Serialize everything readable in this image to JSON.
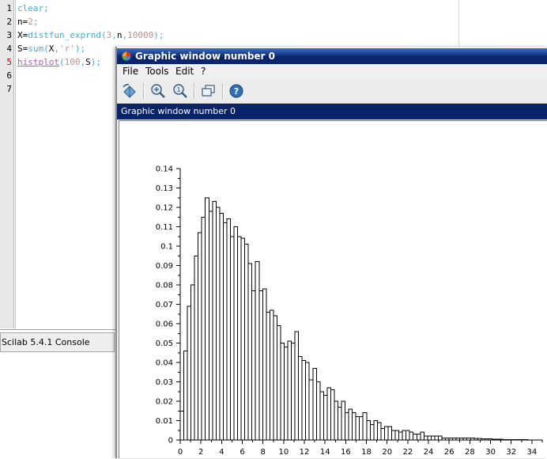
{
  "editor": {
    "line_numbers": [
      "1",
      "2",
      "3",
      "4",
      "5",
      "6",
      "7"
    ],
    "lines": [
      [
        {
          "t": "clear",
          "c": "c-kw"
        },
        {
          "t": ";",
          "c": "c-kw"
        }
      ],
      [
        {
          "t": "n",
          "c": "c-plain"
        },
        {
          "t": "=",
          "c": "c-plain"
        },
        {
          "t": "2",
          "c": "c-num"
        },
        {
          "t": ";",
          "c": "c-kw"
        }
      ],
      [
        {
          "t": "X",
          "c": "c-plain"
        },
        {
          "t": "=",
          "c": "c-plain"
        },
        {
          "t": "distfun_exprnd",
          "c": "c-fn"
        },
        {
          "t": "(",
          "c": "c-kw"
        },
        {
          "t": "3",
          "c": "c-num"
        },
        {
          "t": ",",
          "c": "c-kw"
        },
        {
          "t": "n",
          "c": "c-plain"
        },
        {
          "t": ",",
          "c": "c-kw"
        },
        {
          "t": "10000",
          "c": "c-num"
        },
        {
          "t": ");",
          "c": "c-kw"
        }
      ],
      [
        {
          "t": "S",
          "c": "c-plain"
        },
        {
          "t": "=",
          "c": "c-plain"
        },
        {
          "t": "sum",
          "c": "c-fn"
        },
        {
          "t": "(",
          "c": "c-kw"
        },
        {
          "t": "X",
          "c": "c-plain"
        },
        {
          "t": ",",
          "c": "c-kw"
        },
        {
          "t": "'r'",
          "c": "c-str"
        },
        {
          "t": ");",
          "c": "c-kw"
        }
      ],
      [
        {
          "t": "histplot",
          "c": "c-macro"
        },
        {
          "t": "(",
          "c": "c-kw"
        },
        {
          "t": "100",
          "c": "c-num"
        },
        {
          "t": ",",
          "c": "c-kw"
        },
        {
          "t": "S",
          "c": "c-plain"
        },
        {
          "t": ");",
          "c": "c-kw"
        }
      ],
      [],
      []
    ],
    "active_line": 5
  },
  "console": {
    "title": "Scilab 5.4.1 Console"
  },
  "graphic_window": {
    "title": "Graphic window number 0",
    "menus": [
      "File",
      "Tools",
      "Edit",
      "?"
    ],
    "toolbar_icons": [
      "rotate-icon",
      "zoom-in-icon",
      "zoom-out-icon",
      "datatip-icon",
      "help-icon"
    ],
    "subtitle": "Graphic window number 0"
  },
  "colors": {
    "title_gradient_dark": "#0a246a",
    "title_gradient_light": "#3a6fc7",
    "keyword": "#4faac9",
    "number": "#bc8f8f",
    "macro": "#ae5cb0"
  },
  "chart_data": {
    "type": "bar",
    "title": "",
    "xlabel": "",
    "ylabel": "",
    "xlim": [
      0,
      35
    ],
    "ylim": [
      0,
      0.14
    ],
    "x_ticks": [
      "0",
      "2",
      "4",
      "6",
      "8",
      "10",
      "12",
      "14",
      "16",
      "18",
      "20",
      "22",
      "24",
      "26",
      "28",
      "30",
      "32",
      "34"
    ],
    "y_ticks": [
      "0",
      "0.01",
      "0.02",
      "0.03",
      "0.04",
      "0.05",
      "0.06",
      "0.07",
      "0.08",
      "0.09",
      "0.1",
      "0.11",
      "0.12",
      "0.13",
      "0.14"
    ],
    "bin_width": 0.3465,
    "bin_start": 0.0,
    "values": [
      0.015,
      0.046,
      0.069,
      0.08,
      0.095,
      0.107,
      0.115,
      0.125,
      0.118,
      0.123,
      0.12,
      0.117,
      0.112,
      0.114,
      0.105,
      0.11,
      0.105,
      0.104,
      0.101,
      0.091,
      0.077,
      0.092,
      0.077,
      0.078,
      0.066,
      0.067,
      0.064,
      0.059,
      0.05,
      0.048,
      0.051,
      0.05,
      0.056,
      0.043,
      0.041,
      0.04,
      0.031,
      0.037,
      0.03,
      0.025,
      0.023,
      0.027,
      0.026,
      0.02,
      0.017,
      0.02,
      0.014,
      0.016,
      0.014,
      0.012,
      0.012,
      0.014,
      0.01,
      0.008,
      0.01,
      0.009,
      0.006,
      0.007,
      0.007,
      0.005,
      0.005,
      0.004,
      0.005,
      0.005,
      0.004,
      0.003,
      0.003,
      0.004,
      0.002,
      0.002,
      0.002,
      0.002,
      0.002,
      0.001,
      0.001,
      0.001,
      0.001,
      0.001,
      0.001,
      0.001,
      0.001,
      0.001,
      0.0008,
      0.0008,
      0.0006,
      0.0006,
      0.0006,
      0.0004,
      0.0004,
      0.0004,
      0.0003,
      0.0003,
      0.0003,
      0.0002,
      0.0002,
      0.0002,
      0.0002,
      0.0001,
      0.0001,
      0.0001
    ],
    "bar_fill": "#ffffff",
    "bar_stroke": "#000000",
    "grid": false,
    "legend": "none"
  }
}
